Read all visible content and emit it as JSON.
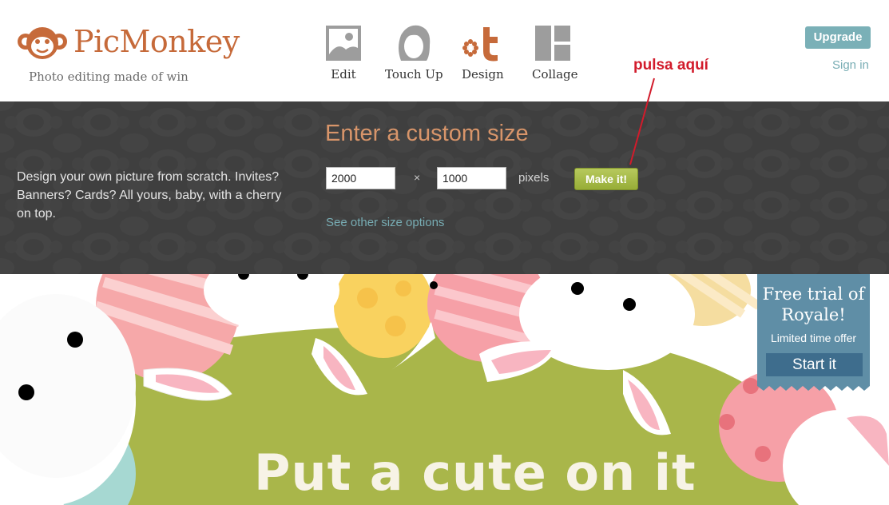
{
  "brand": {
    "name": "PicMonkey",
    "tagline": "Photo editing made of win",
    "color": "#c66a3a"
  },
  "nav": {
    "items": [
      {
        "label": "Edit",
        "icon": "photo-icon"
      },
      {
        "label": "Touch Up",
        "icon": "face-icon"
      },
      {
        "label": "Design",
        "icon": "design-icon"
      },
      {
        "label": "Collage",
        "icon": "collage-icon"
      }
    ]
  },
  "account": {
    "upgrade_label": "Upgrade",
    "signin_label": "Sign in"
  },
  "annotation": {
    "text": "pulsa aquí",
    "color": "#d21b2b"
  },
  "custom_size": {
    "description": "Design your own picture from scratch. Invites? Banners? Cards? All yours, baby, with a cherry on top.",
    "title": "Enter a custom size",
    "width_value": "2000",
    "height_value": "1000",
    "times_symbol": "×",
    "unit_label": "pixels",
    "submit_label": "Make it!",
    "other_sizes_link": "See other size options"
  },
  "hero": {
    "title": "Put a cute on it"
  },
  "promo": {
    "title": "Free trial of Royale!",
    "subtitle": "Limited time offer",
    "button_label": "Start it"
  },
  "colors": {
    "accent_teal": "#78adb4",
    "panel_bg": "#3f3f3f",
    "make_btn": "#a5bb45",
    "hero_green": "#a9b64a",
    "promo_blue": "#5f8ea6"
  }
}
